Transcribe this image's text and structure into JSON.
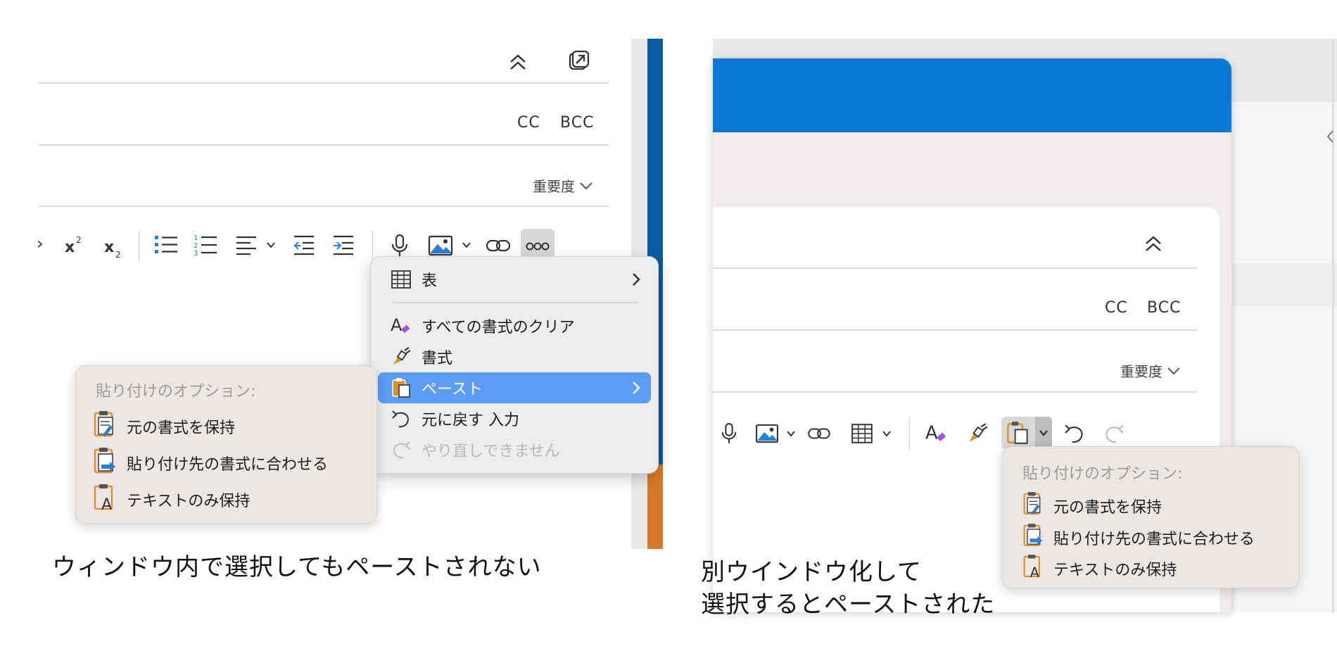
{
  "left": {
    "fields": {
      "cc": "CC",
      "bcc": "BCC",
      "importance": "重要度"
    },
    "toolbar_partial": "›",
    "context_menu": {
      "items": [
        {
          "label": "表",
          "icon": "table-icon",
          "submenu": true
        },
        {
          "label": "すべての書式のクリア",
          "icon": "clear-formatting-icon"
        },
        {
          "label": "書式",
          "icon": "format-painter-icon"
        },
        {
          "label": "ペースト",
          "icon": "paste-icon",
          "submenu": true,
          "active": true
        },
        {
          "label": "元に戻す 入力",
          "icon": "undo-icon"
        },
        {
          "label": "やり直しできません",
          "icon": "redo-icon",
          "disabled": true
        }
      ]
    },
    "paste_options": {
      "header": "貼り付けのオプション:",
      "items": [
        {
          "label": "元の書式を保持",
          "icon": "keep-source-formatting-icon"
        },
        {
          "label": "貼り付け先の書式に合わせる",
          "icon": "match-destination-formatting-icon"
        },
        {
          "label": "テキストのみ保持",
          "icon": "keep-text-only-icon"
        }
      ]
    },
    "caption": "ウィンドウ内で選択してもペーストされない"
  },
  "right": {
    "fields": {
      "cc": "CC",
      "bcc": "BCC",
      "importance": "重要度"
    },
    "paste_options": {
      "header": "貼り付けのオプション:",
      "items": [
        {
          "label": "元の書式を保持",
          "icon": "keep-source-formatting-icon"
        },
        {
          "label": "貼り付け先の書式に合わせる",
          "icon": "match-destination-formatting-icon"
        },
        {
          "label": "テキストのみ保持",
          "icon": "keep-text-only-icon"
        }
      ]
    },
    "caption_line1": "別ウインドウ化して",
    "caption_line2": "選択するとペーストされた"
  },
  "colors": {
    "accent_blue": "#0b78d6",
    "menu_highlight": "#5b9cf5",
    "paste_icon_orange": "#e0902b",
    "arrow_blue": "#2d7fd6"
  }
}
